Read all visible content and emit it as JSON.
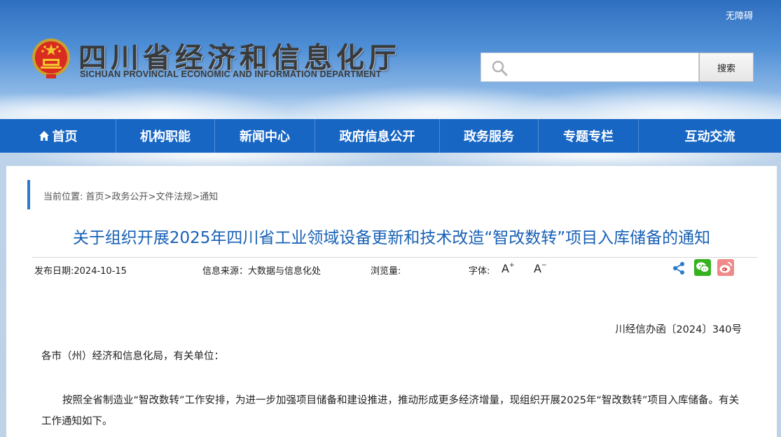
{
  "header": {
    "accessibility_label": "无障碍",
    "title_cn": "四川省经济和信息化厅",
    "title_en": "SICHUAN PROVINCIAL ECONOMIC AND INFORMATION DEPARTMENT",
    "search_placeholder": "",
    "search_button_label": "搜索"
  },
  "nav": {
    "items": [
      {
        "label": "首页",
        "icon": "home-icon"
      },
      {
        "label": "机构职能"
      },
      {
        "label": "新闻中心"
      },
      {
        "label": "政府信息公开"
      },
      {
        "label": "政务服务"
      },
      {
        "label": "专题专栏"
      },
      {
        "label": "互动交流"
      }
    ]
  },
  "breadcrumb": {
    "prefix": "当前位置: ",
    "items": [
      "首页",
      "政务公开",
      "文件法规",
      "通知"
    ],
    "separator": ">"
  },
  "article": {
    "title": "关于组织开展2025年四川省工业领域设备更新和技术改造“智改数转”项目入库储备的通知",
    "publish_date": "发布日期:2024-10-15",
    "source": "信息来源：大数据与信息化处",
    "views": "浏览量:",
    "font_label": "字体:",
    "font_increase": "A",
    "font_decrease": "A",
    "doc_number": "川经信办函〔2024〕340号",
    "salutation": "各市（州）经济和信息化局，有关单位：",
    "paragraph": "按照全省制造业“智改数转”工作安排，为进一步加强项目储备和建设推进，推动形成更多经济增量，现组织开展2025年“智改数转”项目入库储备。有关工作通知如下。"
  },
  "share": {
    "icons": [
      "share-icon",
      "wechat-icon",
      "weibo-icon"
    ]
  },
  "colors": {
    "nav_bg": "#1766c4",
    "title_color": "#1760b5",
    "breadcrumb_bar": "#2b79cc"
  }
}
